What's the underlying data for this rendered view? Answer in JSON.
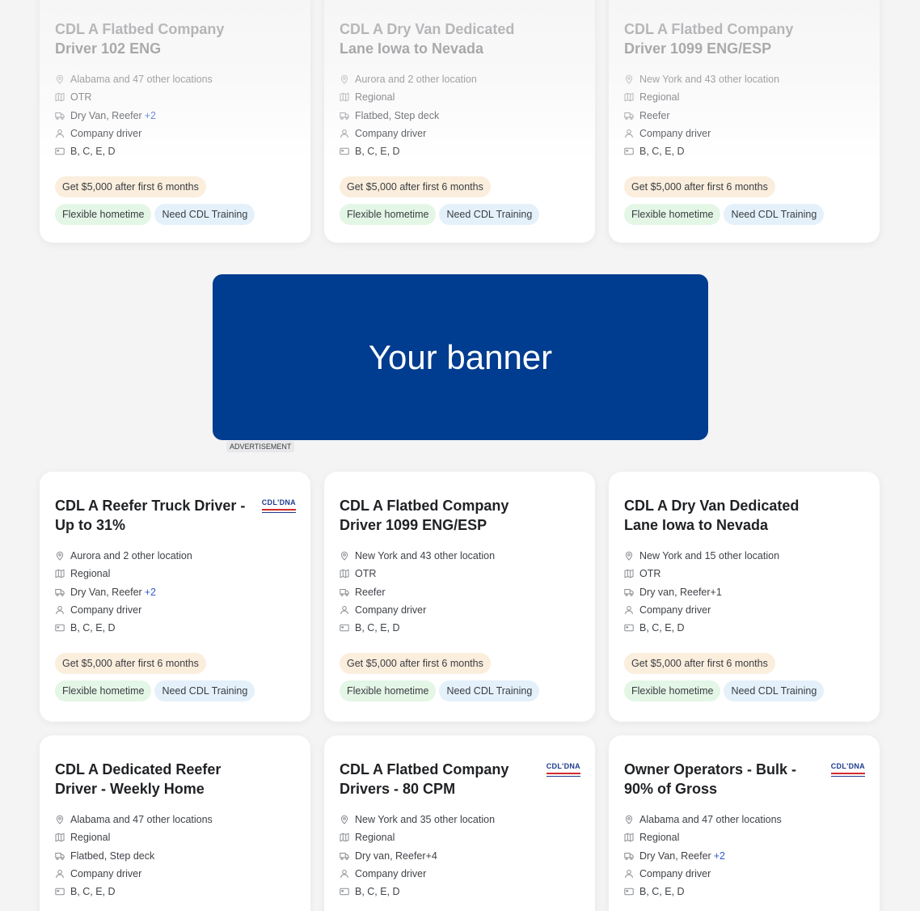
{
  "banner": {
    "text": "Your banner",
    "ad_label": "ADVERTISEMENT",
    "color": "#003c8f"
  },
  "logo_text": "CDL'DNA",
  "top_cards": [
    {
      "title": "CDL A Flatbed Company Driver 102 ENG",
      "location": "Alabama and 47 other locations",
      "route": "OTR",
      "equipment": "Dry Van, Reefer",
      "equipment_more": "+2",
      "driver_type": "Company driver",
      "license": "B, C, E, D",
      "bonus": "Get $5,000 after first 6 months",
      "tag1": "Flexible hometime",
      "tag2": "Need CDL Training"
    },
    {
      "title": "CDL A Dry Van Dedicated Lane Iowa to Nevada",
      "location": "Aurora and 2 other location",
      "route": "Regional",
      "equipment": "Flatbed, Step deck",
      "equipment_more": "",
      "driver_type": "Company driver",
      "license": "B, C, E, D",
      "bonus": "Get $5,000 after first 6 months",
      "tag1": "Flexible hometime",
      "tag2": "Need CDL Training"
    },
    {
      "title": "CDL A Flatbed Company Driver 1099 ENG/ESP",
      "location": "New York and 43 other location",
      "route": "Regional",
      "equipment": "Reefer",
      "equipment_more": "",
      "driver_type": "Company driver",
      "license": "B, C, E, D",
      "bonus": "Get $5,000 after first 6 months",
      "tag1": "Flexible hometime",
      "tag2": "Need CDL Training"
    }
  ],
  "mid_cards": [
    {
      "title": "CDL A Reefer Truck Driver - Up to 31%",
      "location": "Aurora and 2 other location",
      "route": "Regional",
      "equipment": "Dry Van, Reefer",
      "equipment_more": "+2",
      "driver_type": "Company driver",
      "license": "B, C, E, D",
      "bonus": "Get $5,000 after first 6 months",
      "tag1": "Flexible hometime",
      "tag2": "Need CDL Training"
    },
    {
      "title": "CDL A Flatbed Company Driver 1099 ENG/ESP",
      "location": "New York and 43 other location",
      "route": "OTR",
      "equipment": "Reefer",
      "equipment_more": "",
      "driver_type": "Company driver",
      "license": "B, C, E, D",
      "bonus": "Get $5,000 after first 6 months",
      "tag1": "Flexible hometime",
      "tag2": "Need CDL Training"
    },
    {
      "title": "CDL A Dry Van Dedicated Lane Iowa to Nevada",
      "location": "New York and 15 other location",
      "route": "OTR",
      "equipment": "Dry van, Reefer+1",
      "equipment_more": "",
      "driver_type": "Company driver",
      "license": "B, C, E, D",
      "bonus": "Get $5,000 after first 6 months",
      "tag1": "Flexible hometime",
      "tag2": "Need CDL Training"
    }
  ],
  "bot_cards": [
    {
      "title": "CDL A Dedicated Reefer Driver - Weekly Home",
      "location": "Alabama and 47 other locations",
      "route": "Regional",
      "equipment": "Flatbed, Step deck",
      "equipment_more": "",
      "driver_type": "Company driver",
      "license": "B, C, E, D"
    },
    {
      "title": "CDL A Flatbed Company Drivers - 80 CPM",
      "location": "New York and 35 other location",
      "route": "Regional",
      "equipment": "Dry van, Reefer+4",
      "equipment_more": "",
      "driver_type": "Company driver",
      "license": "B, C, E, D"
    },
    {
      "title": "Owner Operators - Bulk - 90% of Gross",
      "location": "Alabama and 47 other locations",
      "route": "Regional",
      "equipment": "Dry Van, Reefer",
      "equipment_more": "+2",
      "driver_type": "Company driver",
      "license": "B, C, E, D"
    }
  ]
}
